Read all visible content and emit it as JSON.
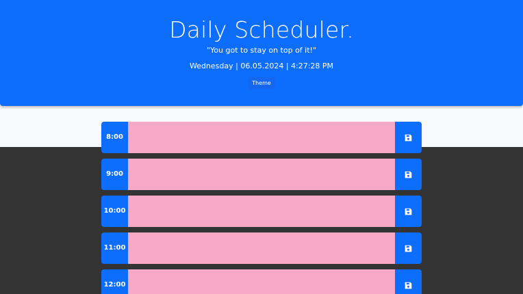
{
  "header": {
    "title": "Daily Scheduler.",
    "tagline": "\"You got to stay on top of it!\"",
    "datetime": "Wednesday | 06.05.2024 | 4:27:28 PM",
    "theme_label": "Theme"
  },
  "colors": {
    "primary": "#0d6efd",
    "timeblock_future": "#f7a8c4",
    "page_dark": "#333333",
    "page_light": "#f8f9fa"
  },
  "schedule": {
    "rows": [
      {
        "hour": "8:00",
        "task": "",
        "save_icon": "floppy-disk-icon"
      },
      {
        "hour": "9:00",
        "task": "",
        "save_icon": "floppy-disk-icon"
      },
      {
        "hour": "10:00",
        "task": "",
        "save_icon": "floppy-disk-icon"
      },
      {
        "hour": "11:00",
        "task": "",
        "save_icon": "floppy-disk-icon"
      },
      {
        "hour": "12:00",
        "task": "",
        "save_icon": "floppy-disk-icon"
      }
    ]
  }
}
